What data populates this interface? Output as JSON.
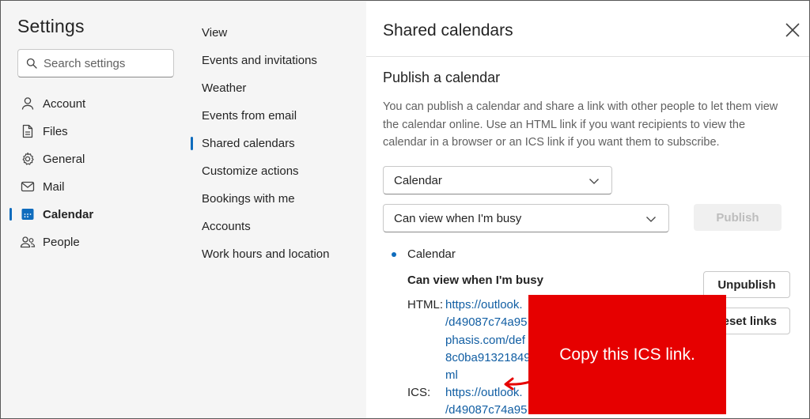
{
  "settings": {
    "title": "Settings",
    "search_placeholder": "Search settings"
  },
  "nav": {
    "items": [
      {
        "label": "Account",
        "icon": "person-icon"
      },
      {
        "label": "Files",
        "icon": "file-icon"
      },
      {
        "label": "General",
        "icon": "gear-icon"
      },
      {
        "label": "Mail",
        "icon": "mail-icon"
      },
      {
        "label": "Calendar",
        "icon": "calendar-icon",
        "active": true
      },
      {
        "label": "People",
        "icon": "people-icon"
      }
    ]
  },
  "subnav": {
    "items": [
      {
        "label": "View"
      },
      {
        "label": "Events and invitations"
      },
      {
        "label": "Weather"
      },
      {
        "label": "Events from email"
      },
      {
        "label": "Shared calendars",
        "active": true
      },
      {
        "label": "Customize actions"
      },
      {
        "label": "Bookings with me"
      },
      {
        "label": "Accounts"
      },
      {
        "label": "Work hours and location"
      }
    ]
  },
  "panel": {
    "title": "Shared calendars",
    "section_title": "Publish a calendar",
    "description": "You can publish a calendar and share a link with other people to let them view the calendar online. Use an HTML link if you want recipients to view the calendar in a browser or an ICS link if you want them to subscribe.",
    "calendar_select": "Calendar",
    "permission_select": "Can view when I'm busy",
    "publish_label": "Publish",
    "published": {
      "calendar_name": "Calendar",
      "permission": "Can view when I'm busy",
      "unpublish_label": "Unpublish",
      "reset_label": "eset links",
      "html_label": "HTML:",
      "html_link_lines": [
        "https://outlook.",
        "/d49087c74a95",
        "phasis.com/def",
        "8c0ba91321849",
        "ml"
      ],
      "ics_label": "ICS:",
      "ics_link_lines": [
        "https://outlook.",
        "/d49087c74a95"
      ]
    }
  },
  "callout": {
    "text": "Copy this ICS link.",
    "color": "#e60000"
  },
  "colors": {
    "accent": "#0f6cbd",
    "link": "#115ea3"
  }
}
